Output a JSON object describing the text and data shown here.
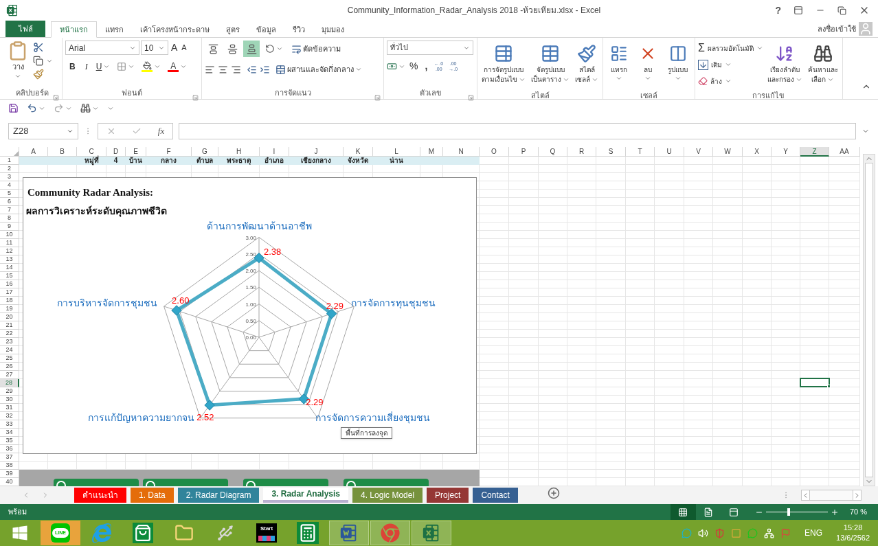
{
  "window": {
    "title": "Community_Information_Radar_Analysis 2018 -ห้วยเหียม.xlsx - Excel",
    "help": "?"
  },
  "ribbon_tabs": [
    {
      "label": "ไฟล์",
      "kind": "file",
      "selected": false
    },
    {
      "label": "หน้าแรก",
      "kind": "tab",
      "selected": true
    },
    {
      "label": "แทรก",
      "kind": "tab",
      "selected": false
    },
    {
      "label": "เค้าโครงหน้ากระดาษ",
      "kind": "tab",
      "selected": false
    },
    {
      "label": "สูตร",
      "kind": "tab",
      "selected": false
    },
    {
      "label": "ข้อมูล",
      "kind": "tab",
      "selected": false
    },
    {
      "label": "รีวิว",
      "kind": "tab",
      "selected": false
    },
    {
      "label": "มุมมอง",
      "kind": "tab",
      "selected": false
    }
  ],
  "account": {
    "label": "ลงชื่อเข้าใช้"
  },
  "ribbon": {
    "clipboard": {
      "title": "คลิปบอร์ด",
      "paste": "วาง"
    },
    "font": {
      "title": "ฟอนต์",
      "font_name": "Arial",
      "font_size": "10",
      "grow": "A",
      "shrink": "A",
      "bold": "B",
      "italic": "I",
      "underline": "U",
      "font_color": "A"
    },
    "alignment": {
      "title": "การจัดแนว",
      "wrap": "ตัดข้อความ",
      "merge": "ผสานและจัดกึ่งกลาง",
      "vertical": [
        {
          "selected": false
        },
        {
          "selected": false
        },
        {
          "selected": true
        }
      ]
    },
    "number": {
      "title": "ตัวเลข",
      "format": "ทั่วไป",
      "percent": "%",
      "comma": ",",
      "decimals": [
        {
          "top": "←.0",
          "bottom": ".00"
        },
        {
          "top": ".00",
          "bottom": "→.0"
        }
      ]
    },
    "styles": {
      "title": "สไตล์",
      "buttons": [
        {
          "kind": "conditional",
          "lines": [
            "การจัดรูปแบบ",
            "ตามเงื่อนไข"
          ]
        },
        {
          "kind": "table",
          "lines": [
            "จัดรูปแบบ",
            "เป็นตาราง"
          ]
        },
        {
          "kind": "cell_styles",
          "lines": [
            "สไตล์",
            "เซลล์"
          ]
        }
      ]
    },
    "cells": {
      "title": "เซลล์",
      "buttons": [
        {
          "kind": "insert",
          "label": "แทรก"
        },
        {
          "kind": "delete",
          "label": "ลบ"
        },
        {
          "kind": "format",
          "label": "รูปแบบ"
        }
      ]
    },
    "editing": {
      "title": "การแก้ไข",
      "autosum_sign": "Σ",
      "autosum": "ผลรวมอัตโนมัติ",
      "fill": "เติม",
      "clear": "ล้าง",
      "buttons": [
        {
          "kind": "sort",
          "lines": [
            "เรียงลำดับ",
            "และกรอง"
          ]
        },
        {
          "kind": "find",
          "lines": [
            "ค้นหาและ",
            "เลือก"
          ]
        }
      ]
    }
  },
  "formula_bar": {
    "name_box": "Z28",
    "fx": "fx"
  },
  "columns": [
    {
      "label": "A",
      "selected": false
    },
    {
      "label": "B",
      "selected": false
    },
    {
      "label": "C",
      "selected": false
    },
    {
      "label": "D",
      "selected": false
    },
    {
      "label": "E",
      "selected": false
    },
    {
      "label": "F",
      "selected": false
    },
    {
      "label": "G",
      "selected": false
    },
    {
      "label": "H",
      "selected": false
    },
    {
      "label": "I",
      "selected": false
    },
    {
      "label": "J",
      "selected": false
    },
    {
      "label": "K",
      "selected": false
    },
    {
      "label": "L",
      "selected": false
    },
    {
      "label": "M",
      "selected": false
    },
    {
      "label": "N",
      "selected": false
    },
    {
      "label": "O",
      "selected": false
    },
    {
      "label": "P",
      "selected": false
    },
    {
      "label": "Q",
      "selected": false
    },
    {
      "label": "R",
      "selected": false
    },
    {
      "label": "S",
      "selected": false
    },
    {
      "label": "T",
      "selected": false
    },
    {
      "label": "U",
      "selected": false
    },
    {
      "label": "V",
      "selected": false
    },
    {
      "label": "W",
      "selected": false
    },
    {
      "label": "X",
      "selected": false
    },
    {
      "label": "Y",
      "selected": false
    },
    {
      "label": "Z",
      "selected": true
    },
    {
      "label": "AA",
      "selected": false
    }
  ],
  "rows": [
    {
      "label": "1",
      "selected": false
    },
    {
      "label": "2",
      "selected": false
    },
    {
      "label": "3",
      "selected": false
    },
    {
      "label": "4",
      "selected": false
    },
    {
      "label": "5",
      "selected": false
    },
    {
      "label": "6",
      "selected": false
    },
    {
      "label": "7",
      "selected": false
    },
    {
      "label": "8",
      "selected": false
    },
    {
      "label": "9",
      "selected": false
    },
    {
      "label": "10",
      "selected": false
    },
    {
      "label": "11",
      "selected": false
    },
    {
      "label": "12",
      "selected": false
    },
    {
      "label": "13",
      "selected": false
    },
    {
      "label": "14",
      "selected": false
    },
    {
      "label": "15",
      "selected": false
    },
    {
      "label": "16",
      "selected": false
    },
    {
      "label": "17",
      "selected": false
    },
    {
      "label": "18",
      "selected": false
    },
    {
      "label": "19",
      "selected": false
    },
    {
      "label": "20",
      "selected": false
    },
    {
      "label": "21",
      "selected": false
    },
    {
      "label": "22",
      "selected": false
    },
    {
      "label": "23",
      "selected": false
    },
    {
      "label": "24",
      "selected": false
    },
    {
      "label": "25",
      "selected": false
    },
    {
      "label": "26",
      "selected": false
    },
    {
      "label": "27",
      "selected": false
    },
    {
      "label": "28",
      "selected": true
    },
    {
      "label": "29",
      "selected": false
    },
    {
      "label": "30",
      "selected": false
    },
    {
      "label": "31",
      "selected": false
    },
    {
      "label": "32",
      "selected": false
    },
    {
      "label": "33",
      "selected": false
    },
    {
      "label": "34",
      "selected": false
    },
    {
      "label": "35",
      "selected": false
    },
    {
      "label": "36",
      "selected": false
    },
    {
      "label": "37",
      "selected": false
    },
    {
      "label": "38",
      "selected": false
    },
    {
      "label": "39",
      "selected": false
    },
    {
      "label": "40",
      "selected": false
    }
  ],
  "banner": [
    "หมู่ที่",
    "4",
    "บ้าน",
    "กลาง",
    "ตำบล",
    "พระธาตุ",
    "อำเภอ",
    "เชียงกลาง",
    "จังหวัด",
    "น่าน"
  ],
  "chart": {
    "title": "Community Radar Analysis:",
    "subtitle": "ผลการวิเคราะห์ระดับคุณภาพชีวิต",
    "tooltip": "พื้นที่การลงจุด",
    "chart_data": {
      "type": "radar",
      "categories": [
        "ด้านการพัฒนาด้านอาชีพ",
        "การจัดการทุนชุมชน",
        "การจัดการความเสี่ยงชุมชน",
        "การแก้ปัญหาความยากจน",
        "การบริหารจัดการชุมชน"
      ],
      "series": [
        {
          "color": "#4bacc6",
          "values": [
            2.38,
            2.29,
            2.29,
            2.52,
            2.6
          ]
        }
      ],
      "ylim": [
        0,
        3
      ],
      "yticks": [
        {
          "value": 0,
          "label": "0.00"
        },
        {
          "value": 0.5,
          "label": "0.50"
        },
        {
          "value": 1,
          "label": "1.00"
        },
        {
          "value": 1.5,
          "label": "1.50"
        },
        {
          "value": 2,
          "label": "2.00"
        },
        {
          "value": 2.5,
          "label": "2.50"
        },
        {
          "value": 3,
          "label": "3.00"
        }
      ],
      "value_labels": [
        "2.38",
        "2.29",
        "2.29",
        "2.52",
        "2.60"
      ]
    }
  },
  "sheet_tabs": [
    {
      "label": "คำแนะนำ",
      "color": "#ff0000",
      "selected": false
    },
    {
      "label": "1. Data",
      "color": "#e46c0a",
      "selected": false
    },
    {
      "label": "2. Radar Diagram",
      "color": "#31849b",
      "selected": false
    },
    {
      "label": "3. Radar Analysis",
      "color": "#b8b0d0",
      "selected": true
    },
    {
      "label": "4. Logic Model",
      "color": "#76923c",
      "selected": false
    },
    {
      "label": "Project",
      "color": "#953735",
      "selected": false
    },
    {
      "label": "Contact",
      "color": "#366092",
      "selected": false
    }
  ],
  "status_bar": {
    "ready": "พร้อม",
    "views": [
      {
        "kind": "normal",
        "selected": true
      },
      {
        "kind": "page_layout",
        "selected": false
      },
      {
        "kind": "page_break",
        "selected": false
      }
    ],
    "zoom": {
      "level": 0.37,
      "label": "70 %"
    }
  },
  "taskbar": {
    "apps": [
      {
        "kind": "line",
        "text": "LINE",
        "open": false,
        "attention": true
      },
      {
        "kind": "ie",
        "open": false,
        "attention": false
      },
      {
        "kind": "store",
        "open": false,
        "attention": false
      },
      {
        "kind": "explorer",
        "open": false,
        "attention": false
      },
      {
        "kind": "usb",
        "open": false,
        "attention": false
      },
      {
        "kind": "start_app",
        "text": "Start",
        "open": false,
        "attention": false
      },
      {
        "kind": "calculator",
        "open": false,
        "attention": false
      },
      {
        "kind": "word",
        "open": true,
        "attention": false
      },
      {
        "kind": "chrome",
        "open": true,
        "attention": false
      },
      {
        "kind": "excel",
        "open": true,
        "attention": false
      }
    ],
    "tray": {
      "icons": [
        {
          "kind": "eset"
        },
        {
          "kind": "volume"
        },
        {
          "kind": "shield"
        },
        {
          "kind": "disk"
        },
        {
          "kind": "chat"
        },
        {
          "kind": "network"
        },
        {
          "kind": "flag"
        }
      ],
      "language": "ENG",
      "time": "15:28",
      "date": "13/6/2562"
    }
  }
}
